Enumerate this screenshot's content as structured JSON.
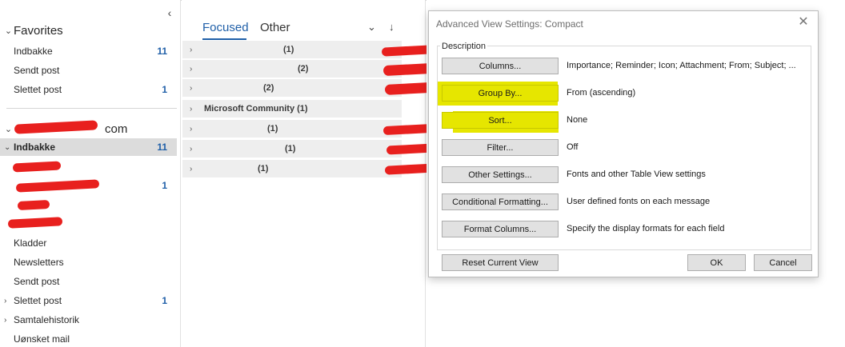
{
  "folder_pane": {
    "favorites_label": "Favorites",
    "favorites": [
      {
        "name": "Indbakke",
        "count": "11"
      },
      {
        "name": "Sendt post",
        "count": ""
      },
      {
        "name": "Slettet post",
        "count": "1"
      }
    ],
    "account_label_suffix": "com",
    "account_folders": [
      {
        "name": "Indbakke",
        "count": "11"
      },
      {
        "name": "",
        "count": ""
      },
      {
        "name": "",
        "count": "1"
      },
      {
        "name": "",
        "count": ""
      },
      {
        "name": "",
        "count": ""
      },
      {
        "name": "Kladder",
        "count": ""
      },
      {
        "name": "Newsletters",
        "count": ""
      },
      {
        "name": "Sendt post",
        "count": ""
      },
      {
        "name": "Slettet post",
        "count": "1"
      },
      {
        "name": "Samtalehistorik",
        "count": ""
      },
      {
        "name": "Uønsket mail",
        "count": ""
      }
    ]
  },
  "message_list": {
    "tab_focused": "Focused",
    "tab_other": "Other",
    "groups": [
      {
        "label": "(1)"
      },
      {
        "label": "(2)"
      },
      {
        "label": "(2)"
      },
      {
        "label": "Microsoft Community (1)"
      },
      {
        "label": "(1)"
      },
      {
        "label": "(1)"
      },
      {
        "label": "(1)"
      }
    ]
  },
  "dialog": {
    "title": "Advanced View Settings: Compact",
    "section_label": "Description",
    "rows": [
      {
        "button": "Columns...",
        "desc": "Importance; Reminder; Icon; Attachment; From; Subject; ..."
      },
      {
        "button": "Group By...",
        "desc": "From (ascending)"
      },
      {
        "button": "Sort...",
        "desc": "None"
      },
      {
        "button": "Filter...",
        "desc": "Off"
      },
      {
        "button": "Other Settings...",
        "desc": "Fonts and other Table View settings"
      },
      {
        "button": "Conditional Formatting...",
        "desc": "User defined fonts on each message"
      },
      {
        "button": "Format Columns...",
        "desc": "Specify the display formats for each field"
      }
    ],
    "reset_label": "Reset Current View",
    "ok_label": "OK",
    "cancel_label": "Cancel"
  },
  "colors": {
    "accent": "#1f5fa8",
    "highlight": "#e6e600",
    "redaction": "#e8201e"
  },
  "icons": {
    "close": "close-icon",
    "collapse": "chevron-left-icon",
    "filter": "chevron-down-icon",
    "sort": "arrow-down-icon"
  }
}
